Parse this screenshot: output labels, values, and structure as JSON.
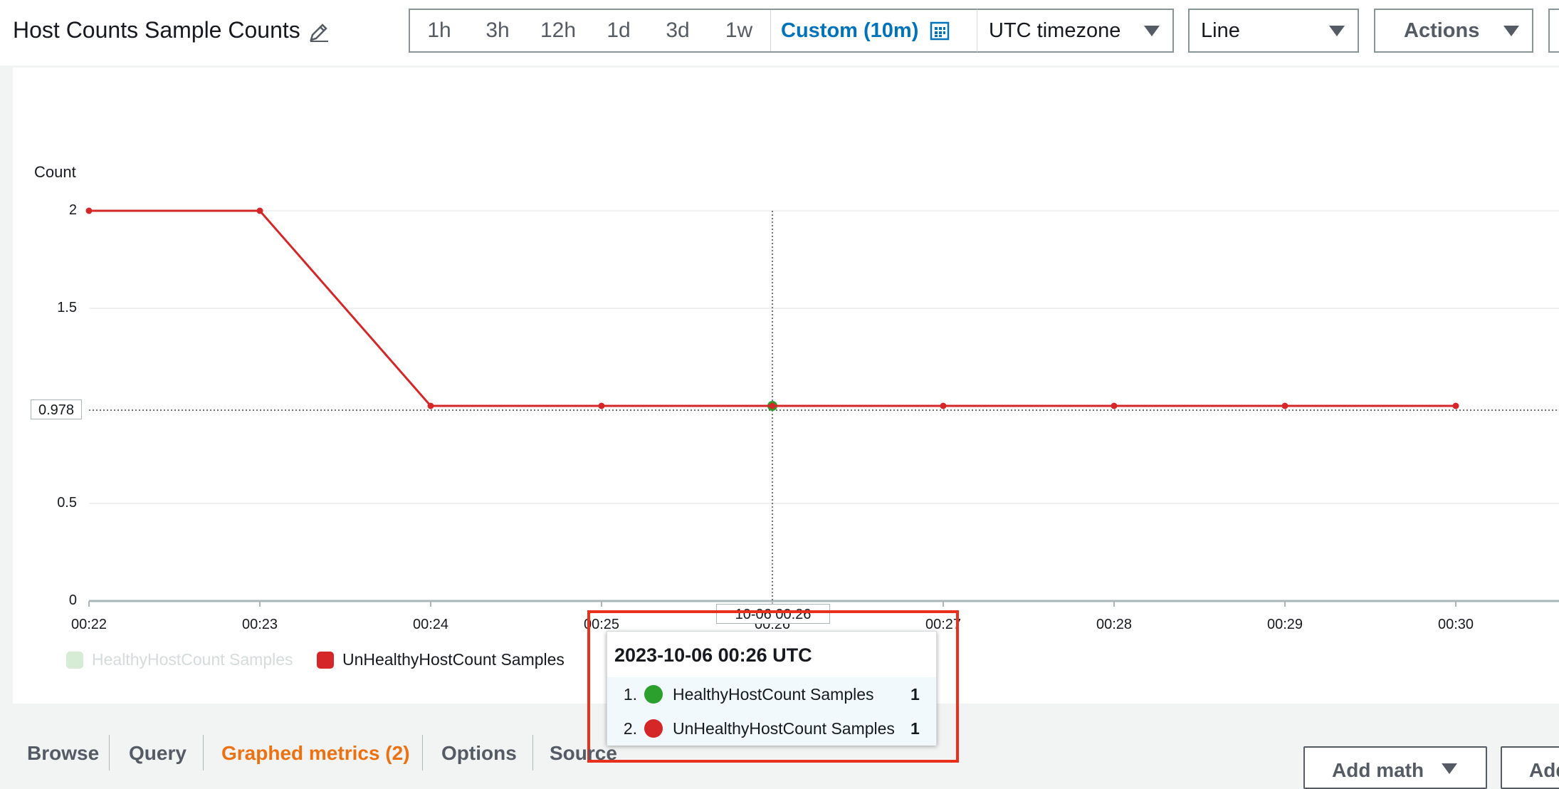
{
  "header": {
    "title": "Host Counts Sample Counts",
    "ranges": [
      "1h",
      "3h",
      "12h",
      "1d",
      "3d",
      "1w"
    ],
    "custom_label": "Custom (10m)",
    "timezone": "UTC timezone",
    "chart_type": "Line",
    "actions_label": "Actions"
  },
  "chart_data": {
    "type": "line",
    "ylabel": "Count",
    "xlabel": "",
    "ylim": [
      0,
      2
    ],
    "yticks": [
      "0",
      "0.5",
      "1.5",
      "2"
    ],
    "x": [
      "00:22",
      "00:23",
      "00:24",
      "00:25",
      "00:26",
      "00:27",
      "00:28",
      "00:29",
      "00:30"
    ],
    "series": [
      {
        "name": "HealthyHostCount Samples",
        "color": "#2ca02c",
        "values": [
          null,
          null,
          null,
          null,
          1,
          null,
          null,
          null,
          null
        ],
        "visible": false
      },
      {
        "name": "UnHealthyHostCount Samples",
        "color": "#d62728",
        "values": [
          2,
          2,
          1,
          1,
          1,
          1,
          1,
          1,
          1
        ],
        "visible": true
      }
    ],
    "grid": true,
    "legend_position": "bottom-left",
    "cursor": {
      "y_label": "0.978",
      "x_label": "10-06 00:26"
    }
  },
  "tooltip": {
    "title": "2023-10-06 00:26 UTC",
    "rows": [
      {
        "index": "1.",
        "name": "HealthyHostCount Samples",
        "value": "1",
        "color": "#2ca02c"
      },
      {
        "index": "2.",
        "name": "UnHealthyHostCount Samples",
        "value": "1",
        "color": "#d62728"
      }
    ]
  },
  "tabs": [
    "Browse",
    "Query",
    "Graphed metrics (2)",
    "Options",
    "Source"
  ],
  "bottom_buttons": {
    "add_math": "Add math",
    "add_query": "Add"
  }
}
